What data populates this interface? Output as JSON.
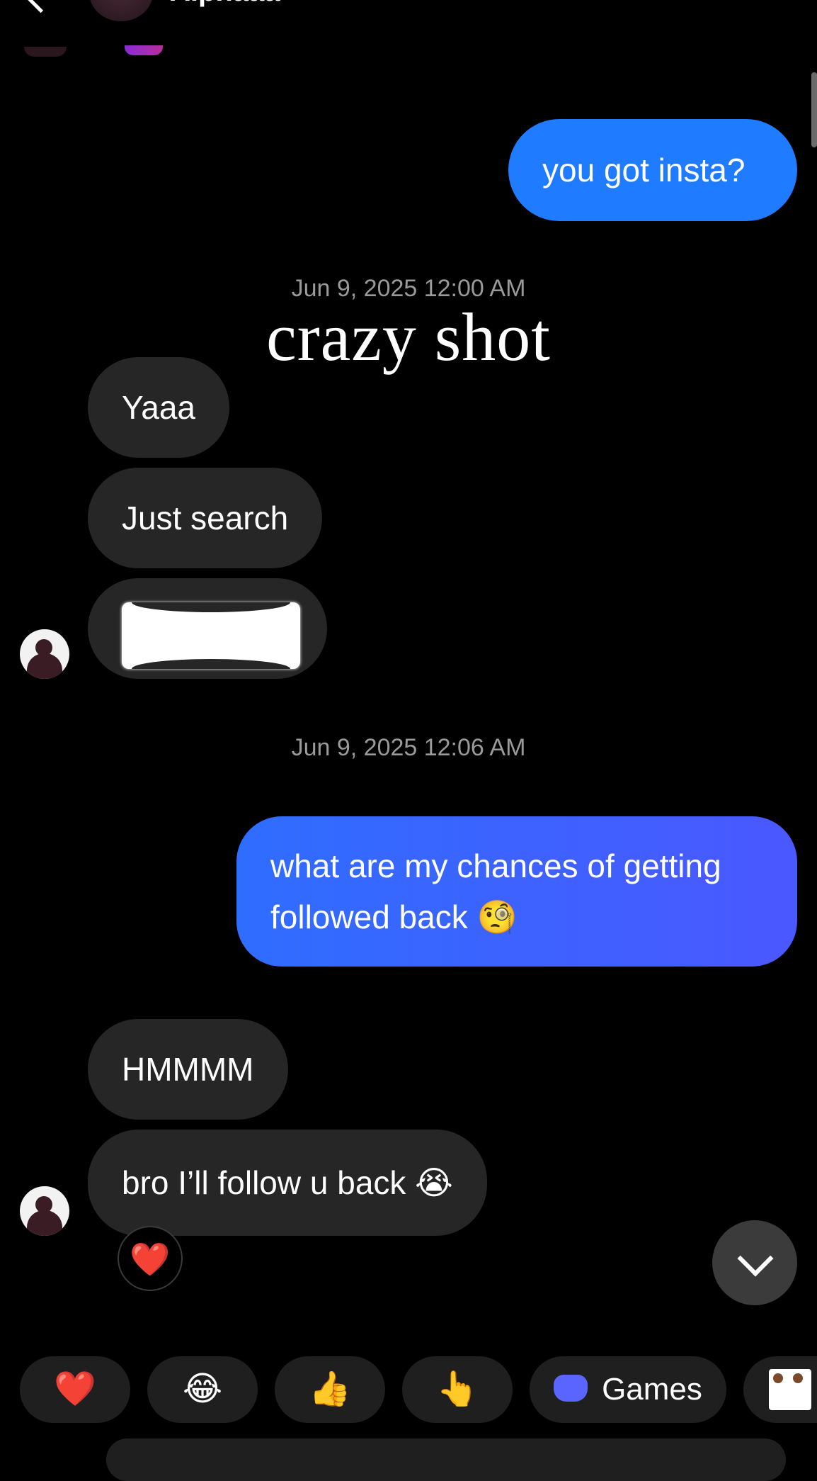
{
  "header": {
    "name": "Alphaaa"
  },
  "messages": [
    {
      "from": "me",
      "text": "you got insta?"
    },
    {
      "type": "timestamp",
      "text": "Jun 9, 2025 12:00 AM"
    },
    {
      "type": "sticker_text",
      "text": "crazy shot"
    },
    {
      "from": "them",
      "text": "Yaaa"
    },
    {
      "from": "them",
      "text": "Just search"
    },
    {
      "from": "them",
      "type": "redacted"
    },
    {
      "type": "timestamp",
      "text": "Jun 9, 2025 12:06 AM"
    },
    {
      "from": "me",
      "line1": "what are my chances of getting",
      "line2": "followed back 🧐"
    },
    {
      "from": "them",
      "text": "HMMMM"
    },
    {
      "from": "them",
      "text": "bro I’ll follow u back 😭",
      "reaction": "❤️"
    }
  ],
  "quick_replies": [
    {
      "label": "❤️"
    },
    {
      "label": "😂"
    },
    {
      "label": "👍"
    },
    {
      "label": "👆"
    },
    {
      "label": "Games",
      "icon": "gamepad-icon"
    },
    {
      "icon": "sticker-icon"
    }
  ],
  "colors": {
    "outgoing": "#1f7bff",
    "outgoing_gradient_end": "#4a58ff",
    "incoming": "#262626",
    "background": "#000000"
  }
}
